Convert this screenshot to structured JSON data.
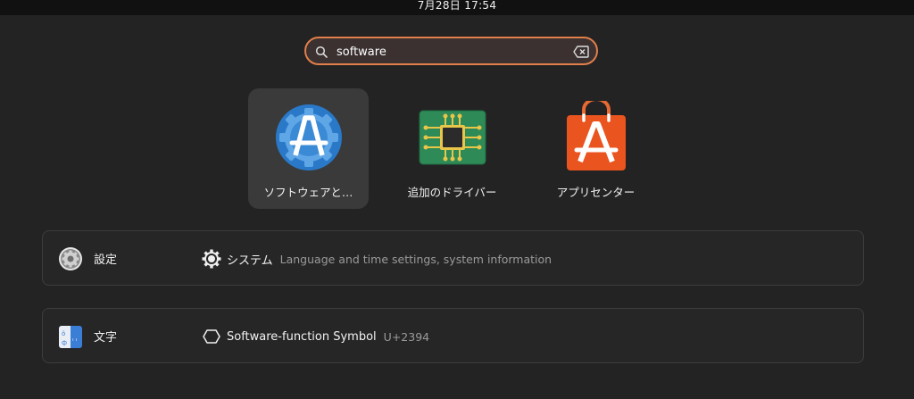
{
  "topbar": {
    "clock": "7月28日  17:54"
  },
  "search": {
    "value": "software",
    "placeholder": ""
  },
  "apps": [
    {
      "label": "ソフトウェアと…",
      "icon": "software-updates-icon",
      "selected": true
    },
    {
      "label": "追加のドライバー",
      "icon": "chip-icon"
    },
    {
      "label": "アプリセンター",
      "icon": "shopping-bag-icon"
    }
  ],
  "providers": [
    {
      "name": "設定",
      "icon": "settings-gear-icon",
      "result": {
        "title": "システム",
        "description": "Language and time settings, system information",
        "icon": "gear-icon"
      }
    },
    {
      "name": "文字",
      "icon": "characters-icon",
      "result": {
        "title": "Software-function Symbol",
        "description": "U+2394",
        "icon": "hexagon-icon"
      }
    }
  ],
  "colors": {
    "accent": "#e07f4a",
    "background": "#232323",
    "selected": "#3a3a3a"
  }
}
